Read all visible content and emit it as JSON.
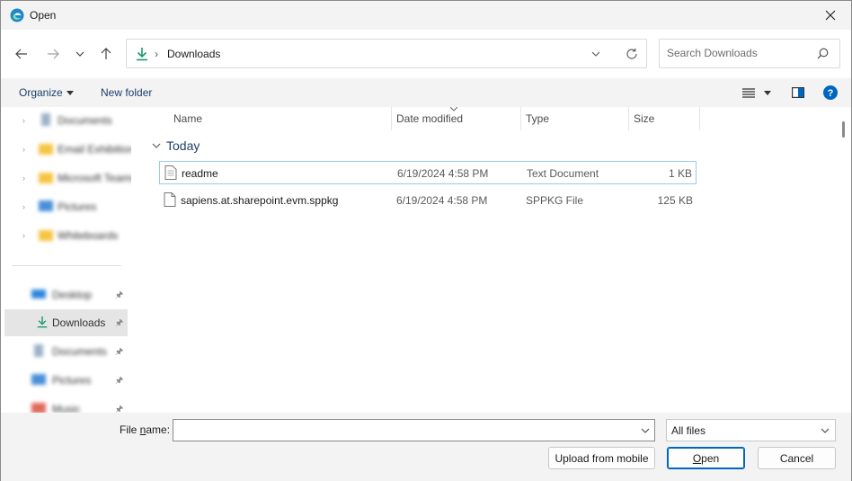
{
  "window": {
    "title": "Open"
  },
  "address": {
    "location": "Downloads",
    "separator": "›"
  },
  "search": {
    "placeholder": "Search Downloads"
  },
  "commandbar": {
    "organize": "Organize",
    "new_folder": "New folder"
  },
  "nav": {
    "top_items": [
      {
        "label": "Documents",
        "icon": "document-icon"
      },
      {
        "label": "Email Exhibition",
        "icon": "folder-icon"
      },
      {
        "label": "Microsoft Teams",
        "icon": "folder-icon"
      },
      {
        "label": "Pictures",
        "icon": "pictures-icon"
      },
      {
        "label": "Whiteboards",
        "icon": "folder-icon"
      }
    ],
    "quick_access": [
      {
        "label": "Desktop",
        "icon": "desktop-icon"
      },
      {
        "label": "Downloads",
        "icon": "download-icon"
      },
      {
        "label": "Documents",
        "icon": "document-icon"
      },
      {
        "label": "Pictures",
        "icon": "pictures-icon"
      },
      {
        "label": "Music",
        "icon": "music-icon"
      }
    ],
    "selected": "Downloads"
  },
  "columns": {
    "name": "Name",
    "date": "Date modified",
    "type": "Type",
    "size": "Size"
  },
  "group": {
    "label": "Today"
  },
  "files": [
    {
      "name": "readme",
      "date": "6/19/2024 4:58 PM",
      "type": "Text Document",
      "size": "1 KB"
    },
    {
      "name": "sapiens.at.sharepoint.evm.sppkg",
      "date": "6/19/2024 4:58 PM",
      "type": "SPPKG File",
      "size": "125 KB"
    }
  ],
  "bottom": {
    "file_name_label_prefix": "File ",
    "file_name_label_mnemonic": "n",
    "file_name_label_suffix": "ame:",
    "file_name_value": "",
    "filter_value": "All files",
    "upload_label": "Upload from mobile",
    "open_mnemonic": "O",
    "open_rest": "pen",
    "cancel_label": "Cancel"
  },
  "colors": {
    "accent": "#0067c0",
    "selection": "#e5e5e5",
    "focus": "#99c9ef"
  }
}
